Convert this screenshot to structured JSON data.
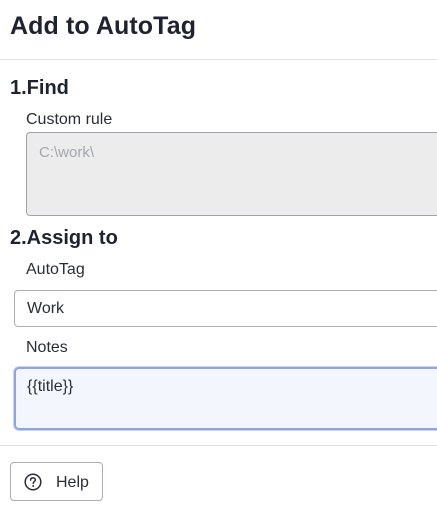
{
  "dialog": {
    "title": "Add to AutoTag"
  },
  "find": {
    "section_title": "1.Find",
    "custom_rule_label": "Custom rule",
    "custom_rule_value": "C:\\work\\"
  },
  "assign": {
    "section_title": "2.Assign to",
    "autotag_label": "AutoTag",
    "autotag_value": "Work",
    "notes_label": "Notes",
    "notes_value": "{{title}}"
  },
  "footer": {
    "help_label": "Help",
    "help_icon": "question-circle-icon"
  },
  "colors": {
    "focus_border": "#8fa6dc",
    "disabled_bg": "#ececec"
  }
}
